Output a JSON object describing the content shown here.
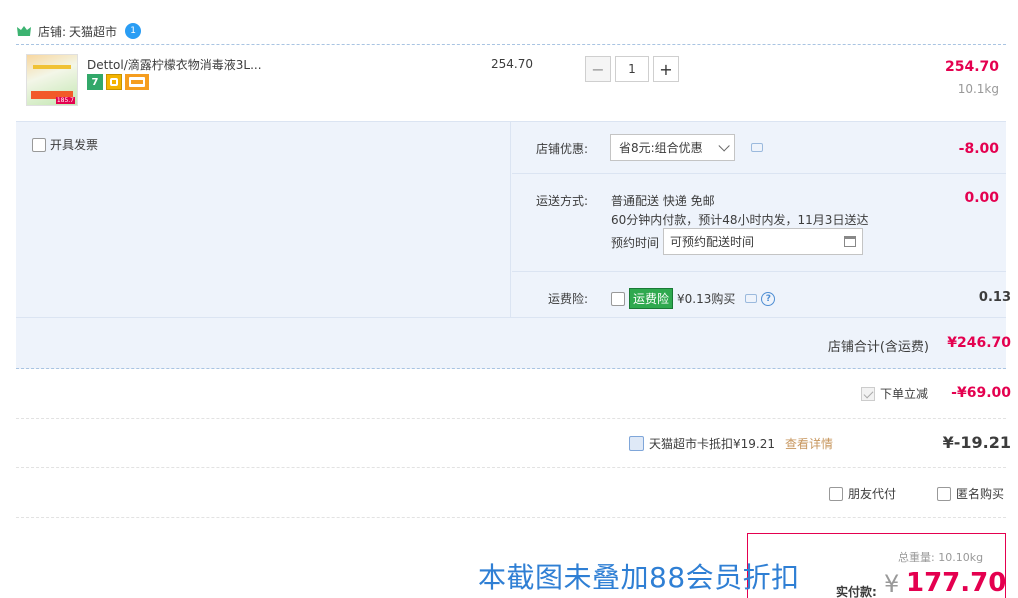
{
  "store": {
    "label": "店铺:",
    "name": "天猫超市",
    "chat_badge": "1"
  },
  "item": {
    "title": "Dettol/滴露柠檬衣物消毒液3L...",
    "thumb_price_tag": "185.7",
    "unit_price": "254.70",
    "quantity": "1",
    "minus": "−",
    "plus": "+",
    "subtotal": "254.70",
    "weight": "10.1kg",
    "tags": [
      "7",
      "",
      ""
    ]
  },
  "options": {
    "invoice_label": "开具发票",
    "store_discount_label": "店铺优惠:",
    "store_discount_value": "省8元:组合优惠",
    "store_discount_amount": "-8.00",
    "shipping_label": "运送方式:",
    "shipping_method": "普通配送 快递 免邮",
    "shipping_desc": "60分钟内付款，预计48小时内发，11月3日送达",
    "schedule_label": "预约时间",
    "schedule_placeholder": "可预约配送时间",
    "shipping_amount": "0.00",
    "insurance_label": "运费险:",
    "insurance_tag": "运费险",
    "insurance_price": "¥0.13购买",
    "insurance_amount": "0.13",
    "help_glyph": "?"
  },
  "store_total": {
    "label": "店铺合计(含运费)",
    "amount": "¥246.70"
  },
  "instant_discount": {
    "label": "下单立减",
    "amount": "-¥69.00"
  },
  "card_deduction": {
    "label": "天猫超市卡抵扣¥19.21",
    "link": "查看详情",
    "amount": "¥-19.21"
  },
  "extra_options": {
    "friend_pay": "朋友代付",
    "anonymous": "匿名购买"
  },
  "summary": {
    "weight_label": "总重量:",
    "weight": "10.10kg",
    "pay_label": "实付款:",
    "currency": "¥",
    "amount": "177.70"
  },
  "overlay_note": "本截图未叠加88会员折扣"
}
